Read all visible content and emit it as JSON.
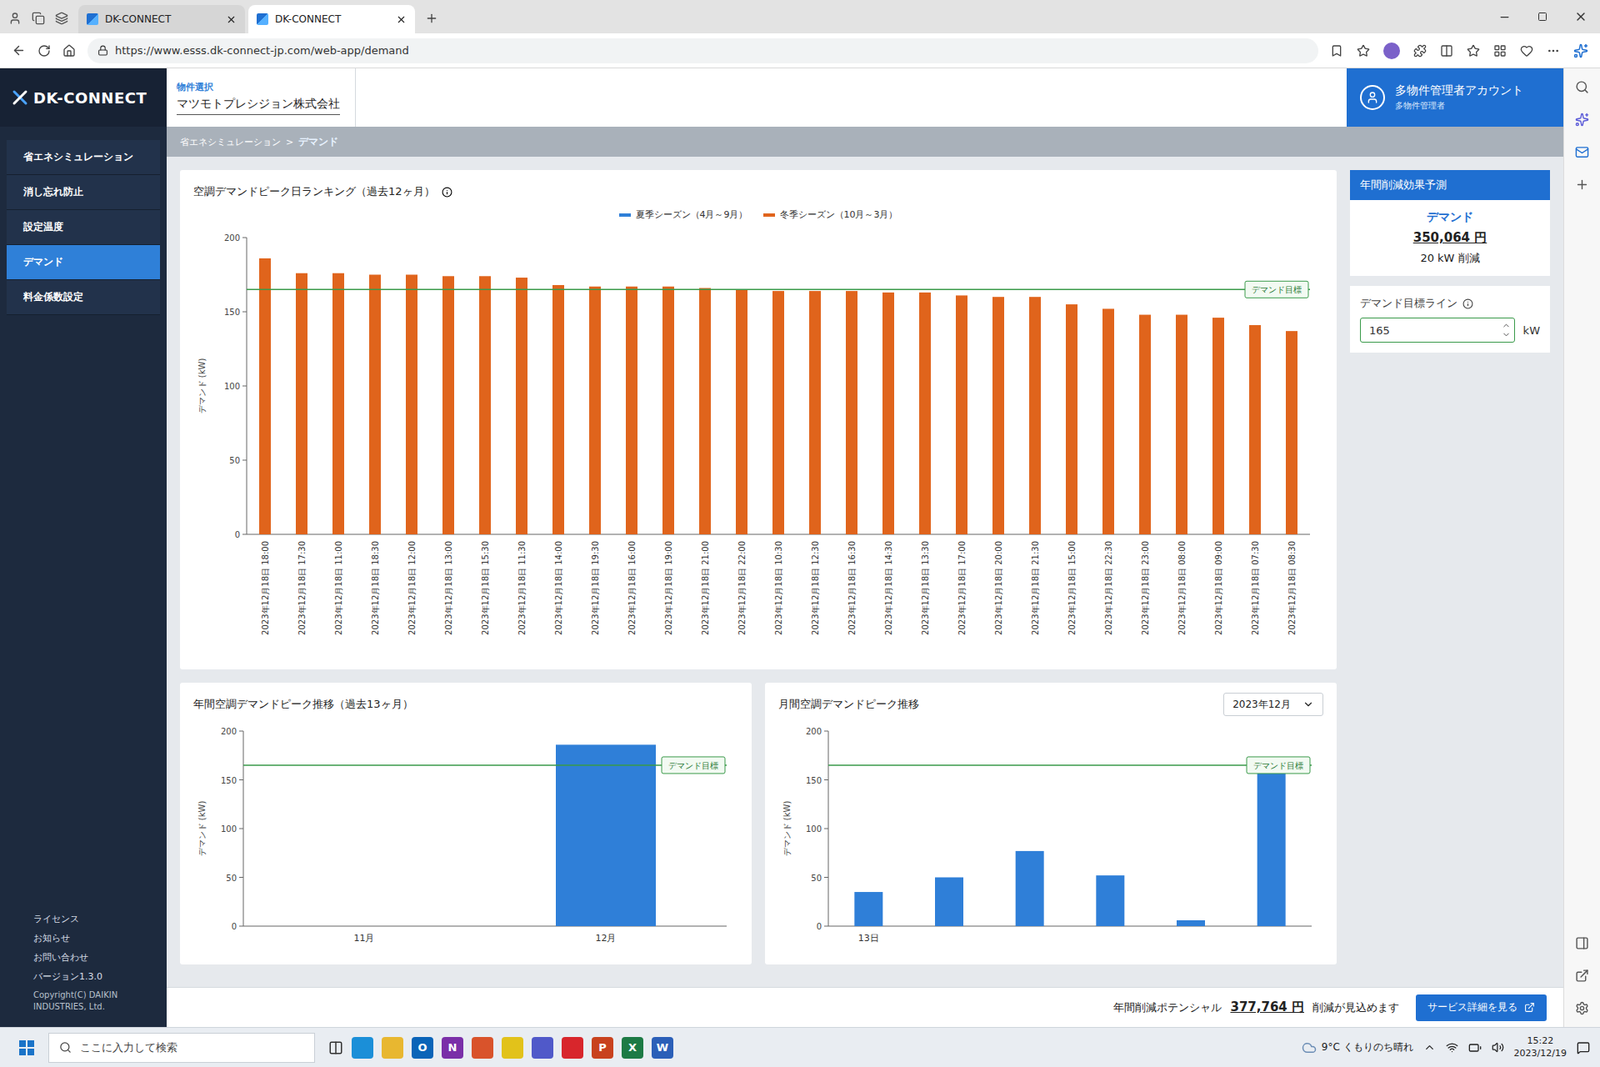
{
  "browser": {
    "tabs": [
      {
        "label": "DK-CONNECT",
        "selected": false
      },
      {
        "label": "DK-CONNECT",
        "selected": true
      }
    ],
    "url": "https://www.esss.dk-connect-jp.com/web-app/demand"
  },
  "app": {
    "logo": "DK-CONNECT",
    "property": {
      "label": "物件選択",
      "value": "マツモトプレシジョン株式会社"
    },
    "account": {
      "title": "多物件管理者アカウント",
      "role": "多物件管理者"
    },
    "sidebar": {
      "items": [
        {
          "label": "省エネシミュレーション",
          "selected": false
        },
        {
          "label": "消し忘れ防止",
          "selected": false
        },
        {
          "label": "設定温度",
          "selected": false
        },
        {
          "label": "デマンド",
          "selected": true
        },
        {
          "label": "料金係数設定",
          "selected": false
        }
      ],
      "footer_links": [
        "ライセンス",
        "お知らせ",
        "お問い合わせ"
      ],
      "version": "バージョン1.3.0",
      "copyright": "Copyright(C) DAIKIN INDUSTRIES, Ltd."
    },
    "breadcrumb": {
      "parent": "省エネシミュレーション",
      "separator": ">",
      "current": "デマンド"
    },
    "ranking_chart": {
      "title": "空調デマンドピーク日ランキング（過去12ヶ月）",
      "legend": [
        {
          "key": "summer",
          "label": "夏季シーズン（4月～9月）",
          "color": "#2f7fd8"
        },
        {
          "key": "winter",
          "label": "冬季シーズン（10月～3月）",
          "color": "#e0641c"
        }
      ],
      "y_label": "デマンド (kW)",
      "y_ticks": [
        "0",
        "50",
        "100",
        "150",
        "200"
      ],
      "y_max": 200,
      "target": 165,
      "target_label": "デマンド目標",
      "bars": [
        {
          "label": "2023年12月18日 18:00",
          "value": 186,
          "season": "winter"
        },
        {
          "label": "2023年12月18日 17:30",
          "value": 176,
          "season": "winter"
        },
        {
          "label": "2023年12月18日 11:00",
          "value": 176,
          "season": "winter"
        },
        {
          "label": "2023年12月18日 18:30",
          "value": 175,
          "season": "winter"
        },
        {
          "label": "2023年12月18日 12:00",
          "value": 175,
          "season": "winter"
        },
        {
          "label": "2023年12月18日 13:00",
          "value": 174,
          "season": "winter"
        },
        {
          "label": "2023年12月18日 15:30",
          "value": 174,
          "season": "winter"
        },
        {
          "label": "2023年12月18日 11:30",
          "value": 173,
          "season": "winter"
        },
        {
          "label": "2023年12月18日 14:00",
          "value": 168,
          "season": "winter"
        },
        {
          "label": "2023年12月18日 19:30",
          "value": 167,
          "season": "winter"
        },
        {
          "label": "2023年12月18日 16:00",
          "value": 167,
          "season": "winter"
        },
        {
          "label": "2023年12月18日 19:00",
          "value": 167,
          "season": "winter"
        },
        {
          "label": "2023年12月18日 21:00",
          "value": 166,
          "season": "winter"
        },
        {
          "label": "2023年12月18日 22:00",
          "value": 165,
          "season": "winter"
        },
        {
          "label": "2023年12月18日 10:30",
          "value": 164,
          "season": "winter"
        },
        {
          "label": "2023年12月18日 12:30",
          "value": 164,
          "season": "winter"
        },
        {
          "label": "2023年12月18日 16:30",
          "value": 164,
          "season": "winter"
        },
        {
          "label": "2023年12月18日 14:30",
          "value": 163,
          "season": "winter"
        },
        {
          "label": "2023年12月18日 13:30",
          "value": 163,
          "season": "winter"
        },
        {
          "label": "2023年12月18日 17:00",
          "value": 161,
          "season": "winter"
        },
        {
          "label": "2023年12月18日 20:00",
          "value": 160,
          "season": "winter"
        },
        {
          "label": "2023年12月18日 21:30",
          "value": 160,
          "season": "winter"
        },
        {
          "label": "2023年12月18日 15:00",
          "value": 155,
          "season": "winter"
        },
        {
          "label": "2023年12月18日 22:30",
          "value": 152,
          "season": "winter"
        },
        {
          "label": "2023年12月18日 23:00",
          "value": 148,
          "season": "winter"
        },
        {
          "label": "2023年12月18日 08:00",
          "value": 148,
          "season": "winter"
        },
        {
          "label": "2023年12月18日 09:00",
          "value": 146,
          "season": "winter"
        },
        {
          "label": "2023年12月18日 07:30",
          "value": 141,
          "season": "winter"
        },
        {
          "label": "2023年12月18日 08:30",
          "value": 137,
          "season": "winter"
        }
      ]
    },
    "annual_chart": {
      "title": "年間空調デマンドピーク推移（過去13ヶ月）",
      "y_label": "デマンド (kW)",
      "y_ticks": [
        "0",
        "50",
        "100",
        "150",
        "200"
      ],
      "y_max": 200,
      "target": 165,
      "target_label": "デマンド目標",
      "bars": [
        {
          "label": "11月",
          "value": 0
        },
        {
          "label": "12月",
          "value": 186
        }
      ]
    },
    "monthly_chart": {
      "title": "月間空調デマンドピーク推移",
      "month_select": "2023年12月",
      "y_label": "デマンド (kW)",
      "y_ticks": [
        "0",
        "50",
        "100",
        "150",
        "200"
      ],
      "y_max": 200,
      "target": 165,
      "target_label": "デマンド目標",
      "bars": [
        {
          "label": "13日",
          "value": 35
        },
        {
          "label": "",
          "value": 50
        },
        {
          "label": "",
          "value": 77
        },
        {
          "label": "",
          "value": 52
        },
        {
          "label": "",
          "value": 6
        },
        {
          "label": "",
          "value": 172
        }
      ]
    },
    "effect_card": {
      "title": "年間削減効果予測",
      "label": "デマンド",
      "amount": "350,064 円",
      "reduction": "20 kW 削減"
    },
    "target_card": {
      "label": "デマンド目標ライン",
      "value": "165",
      "unit": "kW"
    },
    "potential_bar": {
      "label": "年間削減ポテンシャル",
      "amount": "377,764 円",
      "suffix": "削減が見込めます",
      "button": "サービス詳細を見る"
    }
  },
  "taskbar": {
    "search_placeholder": "ここに入力して検索",
    "apps": [
      {
        "color": "#1b8fd8"
      },
      {
        "color": "#e8b730"
      },
      {
        "color": "#0a64b8",
        "glyph": "O"
      },
      {
        "color": "#7a2fa8",
        "glyph": "N"
      },
      {
        "color": "#d9532b"
      },
      {
        "color": "#e2c21a"
      },
      {
        "color": "#5059c9"
      },
      {
        "color": "#d8262c"
      },
      {
        "color": "#c8421e",
        "glyph": "P"
      },
      {
        "color": "#1d7a45",
        "glyph": "X"
      },
      {
        "color": "#2b5fb8",
        "glyph": "W"
      }
    ],
    "weather": "9°C くもりのち晴れ",
    "time": "15:22",
    "date": "2023/12/19"
  }
}
